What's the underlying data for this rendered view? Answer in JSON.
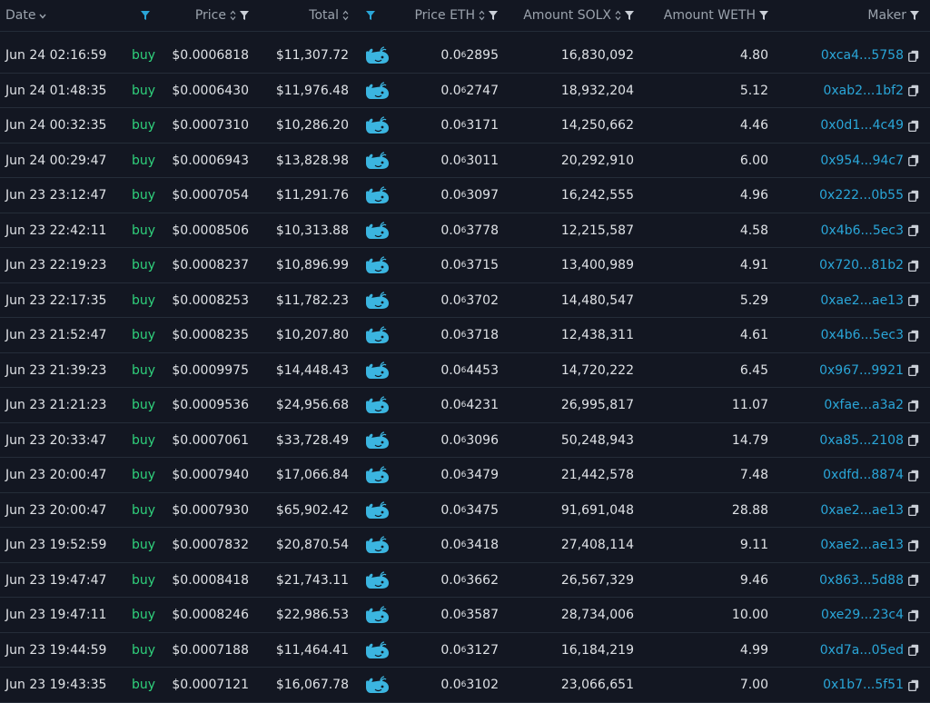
{
  "headers": {
    "date": "Date",
    "price": "Price",
    "total": "Total",
    "price_eth": "Price ETH",
    "amount_solx": "Amount SOLX",
    "amount_weth": "Amount WETH",
    "maker": "Maker"
  },
  "colors": {
    "background": "#131722",
    "buy": "#2fd17c",
    "accent": "#2aa6d8",
    "whale": "#3bb5e0"
  },
  "icons": {
    "filter": "filter-icon",
    "sort": "sort-icon",
    "whale": "whale-icon",
    "copy": "copy-icon"
  },
  "rows": [
    {
      "date": "Jun 24 02:16:59",
      "type": "buy",
      "price": "$0.0006818",
      "total": "$11,307.72",
      "price_eth_prefix": "0.0",
      "price_eth_sub": "6",
      "price_eth_rest": "2895",
      "amount_solx": "16,830,092",
      "amount_weth": "4.80",
      "maker": "0xca4...5758"
    },
    {
      "date": "Jun 24 01:48:35",
      "type": "buy",
      "price": "$0.0006430",
      "total": "$11,976.48",
      "price_eth_prefix": "0.0",
      "price_eth_sub": "6",
      "price_eth_rest": "2747",
      "amount_solx": "18,932,204",
      "amount_weth": "5.12",
      "maker": "0xab2...1bf2"
    },
    {
      "date": "Jun 24 00:32:35",
      "type": "buy",
      "price": "$0.0007310",
      "total": "$10,286.20",
      "price_eth_prefix": "0.0",
      "price_eth_sub": "6",
      "price_eth_rest": "3171",
      "amount_solx": "14,250,662",
      "amount_weth": "4.46",
      "maker": "0x0d1...4c49"
    },
    {
      "date": "Jun 24 00:29:47",
      "type": "buy",
      "price": "$0.0006943",
      "total": "$13,828.98",
      "price_eth_prefix": "0.0",
      "price_eth_sub": "6",
      "price_eth_rest": "3011",
      "amount_solx": "20,292,910",
      "amount_weth": "6.00",
      "maker": "0x954...94c7"
    },
    {
      "date": "Jun 23 23:12:47",
      "type": "buy",
      "price": "$0.0007054",
      "total": "$11,291.76",
      "price_eth_prefix": "0.0",
      "price_eth_sub": "6",
      "price_eth_rest": "3097",
      "amount_solx": "16,242,555",
      "amount_weth": "4.96",
      "maker": "0x222...0b55"
    },
    {
      "date": "Jun 23 22:42:11",
      "type": "buy",
      "price": "$0.0008506",
      "total": "$10,313.88",
      "price_eth_prefix": "0.0",
      "price_eth_sub": "6",
      "price_eth_rest": "3778",
      "amount_solx": "12,215,587",
      "amount_weth": "4.58",
      "maker": "0x4b6...5ec3"
    },
    {
      "date": "Jun 23 22:19:23",
      "type": "buy",
      "price": "$0.0008237",
      "total": "$10,896.99",
      "price_eth_prefix": "0.0",
      "price_eth_sub": "6",
      "price_eth_rest": "3715",
      "amount_solx": "13,400,989",
      "amount_weth": "4.91",
      "maker": "0x720...81b2"
    },
    {
      "date": "Jun 23 22:17:35",
      "type": "buy",
      "price": "$0.0008253",
      "total": "$11,782.23",
      "price_eth_prefix": "0.0",
      "price_eth_sub": "6",
      "price_eth_rest": "3702",
      "amount_solx": "14,480,547",
      "amount_weth": "5.29",
      "maker": "0xae2...ae13"
    },
    {
      "date": "Jun 23 21:52:47",
      "type": "buy",
      "price": "$0.0008235",
      "total": "$10,207.80",
      "price_eth_prefix": "0.0",
      "price_eth_sub": "6",
      "price_eth_rest": "3718",
      "amount_solx": "12,438,311",
      "amount_weth": "4.61",
      "maker": "0x4b6...5ec3"
    },
    {
      "date": "Jun 23 21:39:23",
      "type": "buy",
      "price": "$0.0009975",
      "total": "$14,448.43",
      "price_eth_prefix": "0.0",
      "price_eth_sub": "6",
      "price_eth_rest": "4453",
      "amount_solx": "14,720,222",
      "amount_weth": "6.45",
      "maker": "0x967...9921"
    },
    {
      "date": "Jun 23 21:21:23",
      "type": "buy",
      "price": "$0.0009536",
      "total": "$24,956.68",
      "price_eth_prefix": "0.0",
      "price_eth_sub": "6",
      "price_eth_rest": "4231",
      "amount_solx": "26,995,817",
      "amount_weth": "11.07",
      "maker": "0xfae...a3a2"
    },
    {
      "date": "Jun 23 20:33:47",
      "type": "buy",
      "price": "$0.0007061",
      "total": "$33,728.49",
      "price_eth_prefix": "0.0",
      "price_eth_sub": "6",
      "price_eth_rest": "3096",
      "amount_solx": "50,248,943",
      "amount_weth": "14.79",
      "maker": "0xa85...2108"
    },
    {
      "date": "Jun 23 20:00:47",
      "type": "buy",
      "price": "$0.0007940",
      "total": "$17,066.84",
      "price_eth_prefix": "0.0",
      "price_eth_sub": "6",
      "price_eth_rest": "3479",
      "amount_solx": "21,442,578",
      "amount_weth": "7.48",
      "maker": "0xdfd...8874"
    },
    {
      "date": "Jun 23 20:00:47",
      "type": "buy",
      "price": "$0.0007930",
      "total": "$65,902.42",
      "price_eth_prefix": "0.0",
      "price_eth_sub": "6",
      "price_eth_rest": "3475",
      "amount_solx": "91,691,048",
      "amount_weth": "28.88",
      "maker": "0xae2...ae13"
    },
    {
      "date": "Jun 23 19:52:59",
      "type": "buy",
      "price": "$0.0007832",
      "total": "$20,870.54",
      "price_eth_prefix": "0.0",
      "price_eth_sub": "6",
      "price_eth_rest": "3418",
      "amount_solx": "27,408,114",
      "amount_weth": "9.11",
      "maker": "0xae2...ae13"
    },
    {
      "date": "Jun 23 19:47:47",
      "type": "buy",
      "price": "$0.0008418",
      "total": "$21,743.11",
      "price_eth_prefix": "0.0",
      "price_eth_sub": "6",
      "price_eth_rest": "3662",
      "amount_solx": "26,567,329",
      "amount_weth": "9.46",
      "maker": "0x863...5d88"
    },
    {
      "date": "Jun 23 19:47:11",
      "type": "buy",
      "price": "$0.0008246",
      "total": "$22,986.53",
      "price_eth_prefix": "0.0",
      "price_eth_sub": "6",
      "price_eth_rest": "3587",
      "amount_solx": "28,734,006",
      "amount_weth": "10.00",
      "maker": "0xe29...23c4"
    },
    {
      "date": "Jun 23 19:44:59",
      "type": "buy",
      "price": "$0.0007188",
      "total": "$11,464.41",
      "price_eth_prefix": "0.0",
      "price_eth_sub": "6",
      "price_eth_rest": "3127",
      "amount_solx": "16,184,219",
      "amount_weth": "4.99",
      "maker": "0xd7a...05ed"
    },
    {
      "date": "Jun 23 19:43:35",
      "type": "buy",
      "price": "$0.0007121",
      "total": "$16,067.78",
      "price_eth_prefix": "0.0",
      "price_eth_sub": "6",
      "price_eth_rest": "3102",
      "amount_solx": "23,066,651",
      "amount_weth": "7.00",
      "maker": "0x1b7...5f51"
    }
  ]
}
